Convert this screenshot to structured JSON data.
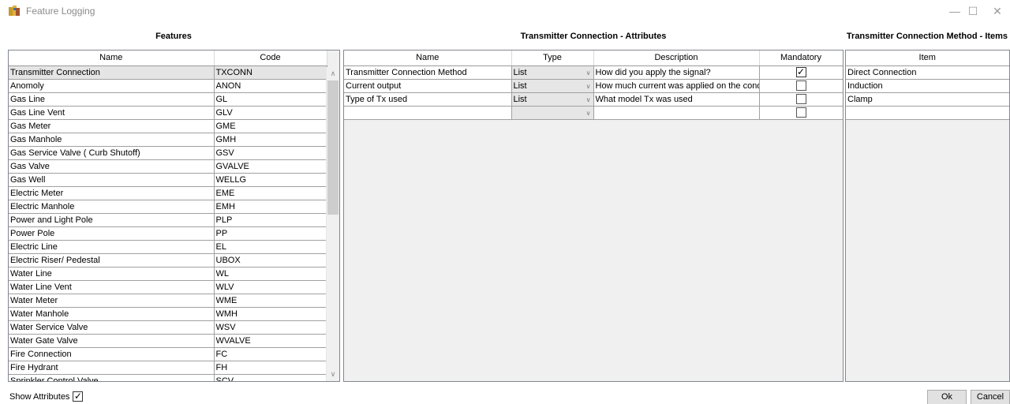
{
  "window": {
    "title": "Feature Logging",
    "minimize_glyph": "—",
    "maximize_glyph": "☐",
    "close_glyph": "✕"
  },
  "features": {
    "title": "Features",
    "columns": [
      "Name",
      "Code"
    ],
    "rows": [
      [
        "Transmitter Connection",
        "TXCONN"
      ],
      [
        "Anomoly",
        "ANON"
      ],
      [
        "Gas Line",
        "GL"
      ],
      [
        "Gas Line Vent",
        "GLV"
      ],
      [
        "Gas Meter",
        "GME"
      ],
      [
        "Gas Manhole",
        "GMH"
      ],
      [
        "Gas Service Valve ( Curb Shutoff)",
        "GSV"
      ],
      [
        "Gas Valve",
        "GVALVE"
      ],
      [
        "Gas Well",
        "WELLG"
      ],
      [
        "Electric Meter",
        "EME"
      ],
      [
        "Electric Manhole",
        "EMH"
      ],
      [
        "Power and Light Pole",
        "PLP"
      ],
      [
        "Power Pole",
        "PP"
      ],
      [
        "Electric Line",
        "EL"
      ],
      [
        "Electric Riser/ Pedestal",
        "UBOX"
      ],
      [
        "Water Line",
        "WL"
      ],
      [
        "Water Line Vent",
        "WLV"
      ],
      [
        "Water Meter",
        "WME"
      ],
      [
        "Water Manhole",
        "WMH"
      ],
      [
        "Water Service Valve",
        "WSV"
      ],
      [
        "Water Gate Valve",
        "WVALVE"
      ],
      [
        "Fire Connection",
        "FC"
      ],
      [
        "Fire Hydrant",
        "FH"
      ],
      [
        "Sprinkler Control Valve",
        "SCV"
      ]
    ],
    "selected_row": 0
  },
  "attributes": {
    "title": "Transmitter Connection - Attributes",
    "columns": [
      "Name",
      "Type",
      "Description",
      "Mandatory"
    ],
    "rows": [
      {
        "name": "Transmitter Connection Method",
        "type": "List",
        "description": "How did you apply the signal?",
        "mandatory": true
      },
      {
        "name": "Current output",
        "type": "List",
        "description": "How much current was applied on the cond",
        "mandatory": false
      },
      {
        "name": "Type of Tx used",
        "type": "List",
        "description": "What model Tx was used",
        "mandatory": false
      },
      {
        "name": "",
        "type": "",
        "description": "",
        "mandatory": false
      }
    ]
  },
  "items": {
    "title": "Transmitter Connection Method - Items",
    "columns": [
      "Item"
    ],
    "rows": [
      "Direct Connection",
      "Induction",
      "Clamp",
      ""
    ]
  },
  "footer": {
    "show_attributes_label": "Show Attributes",
    "show_attributes_checked": true,
    "ok_label": "Ok",
    "cancel_label": "Cancel"
  },
  "icons": {
    "app_icon": "books-icon",
    "dropdown": "chevron-down-icon",
    "check": "✓"
  },
  "colors": {
    "selected_row": "#e5e5e5",
    "type_cell": "#e6e6e6",
    "grid_border": "#828790"
  }
}
